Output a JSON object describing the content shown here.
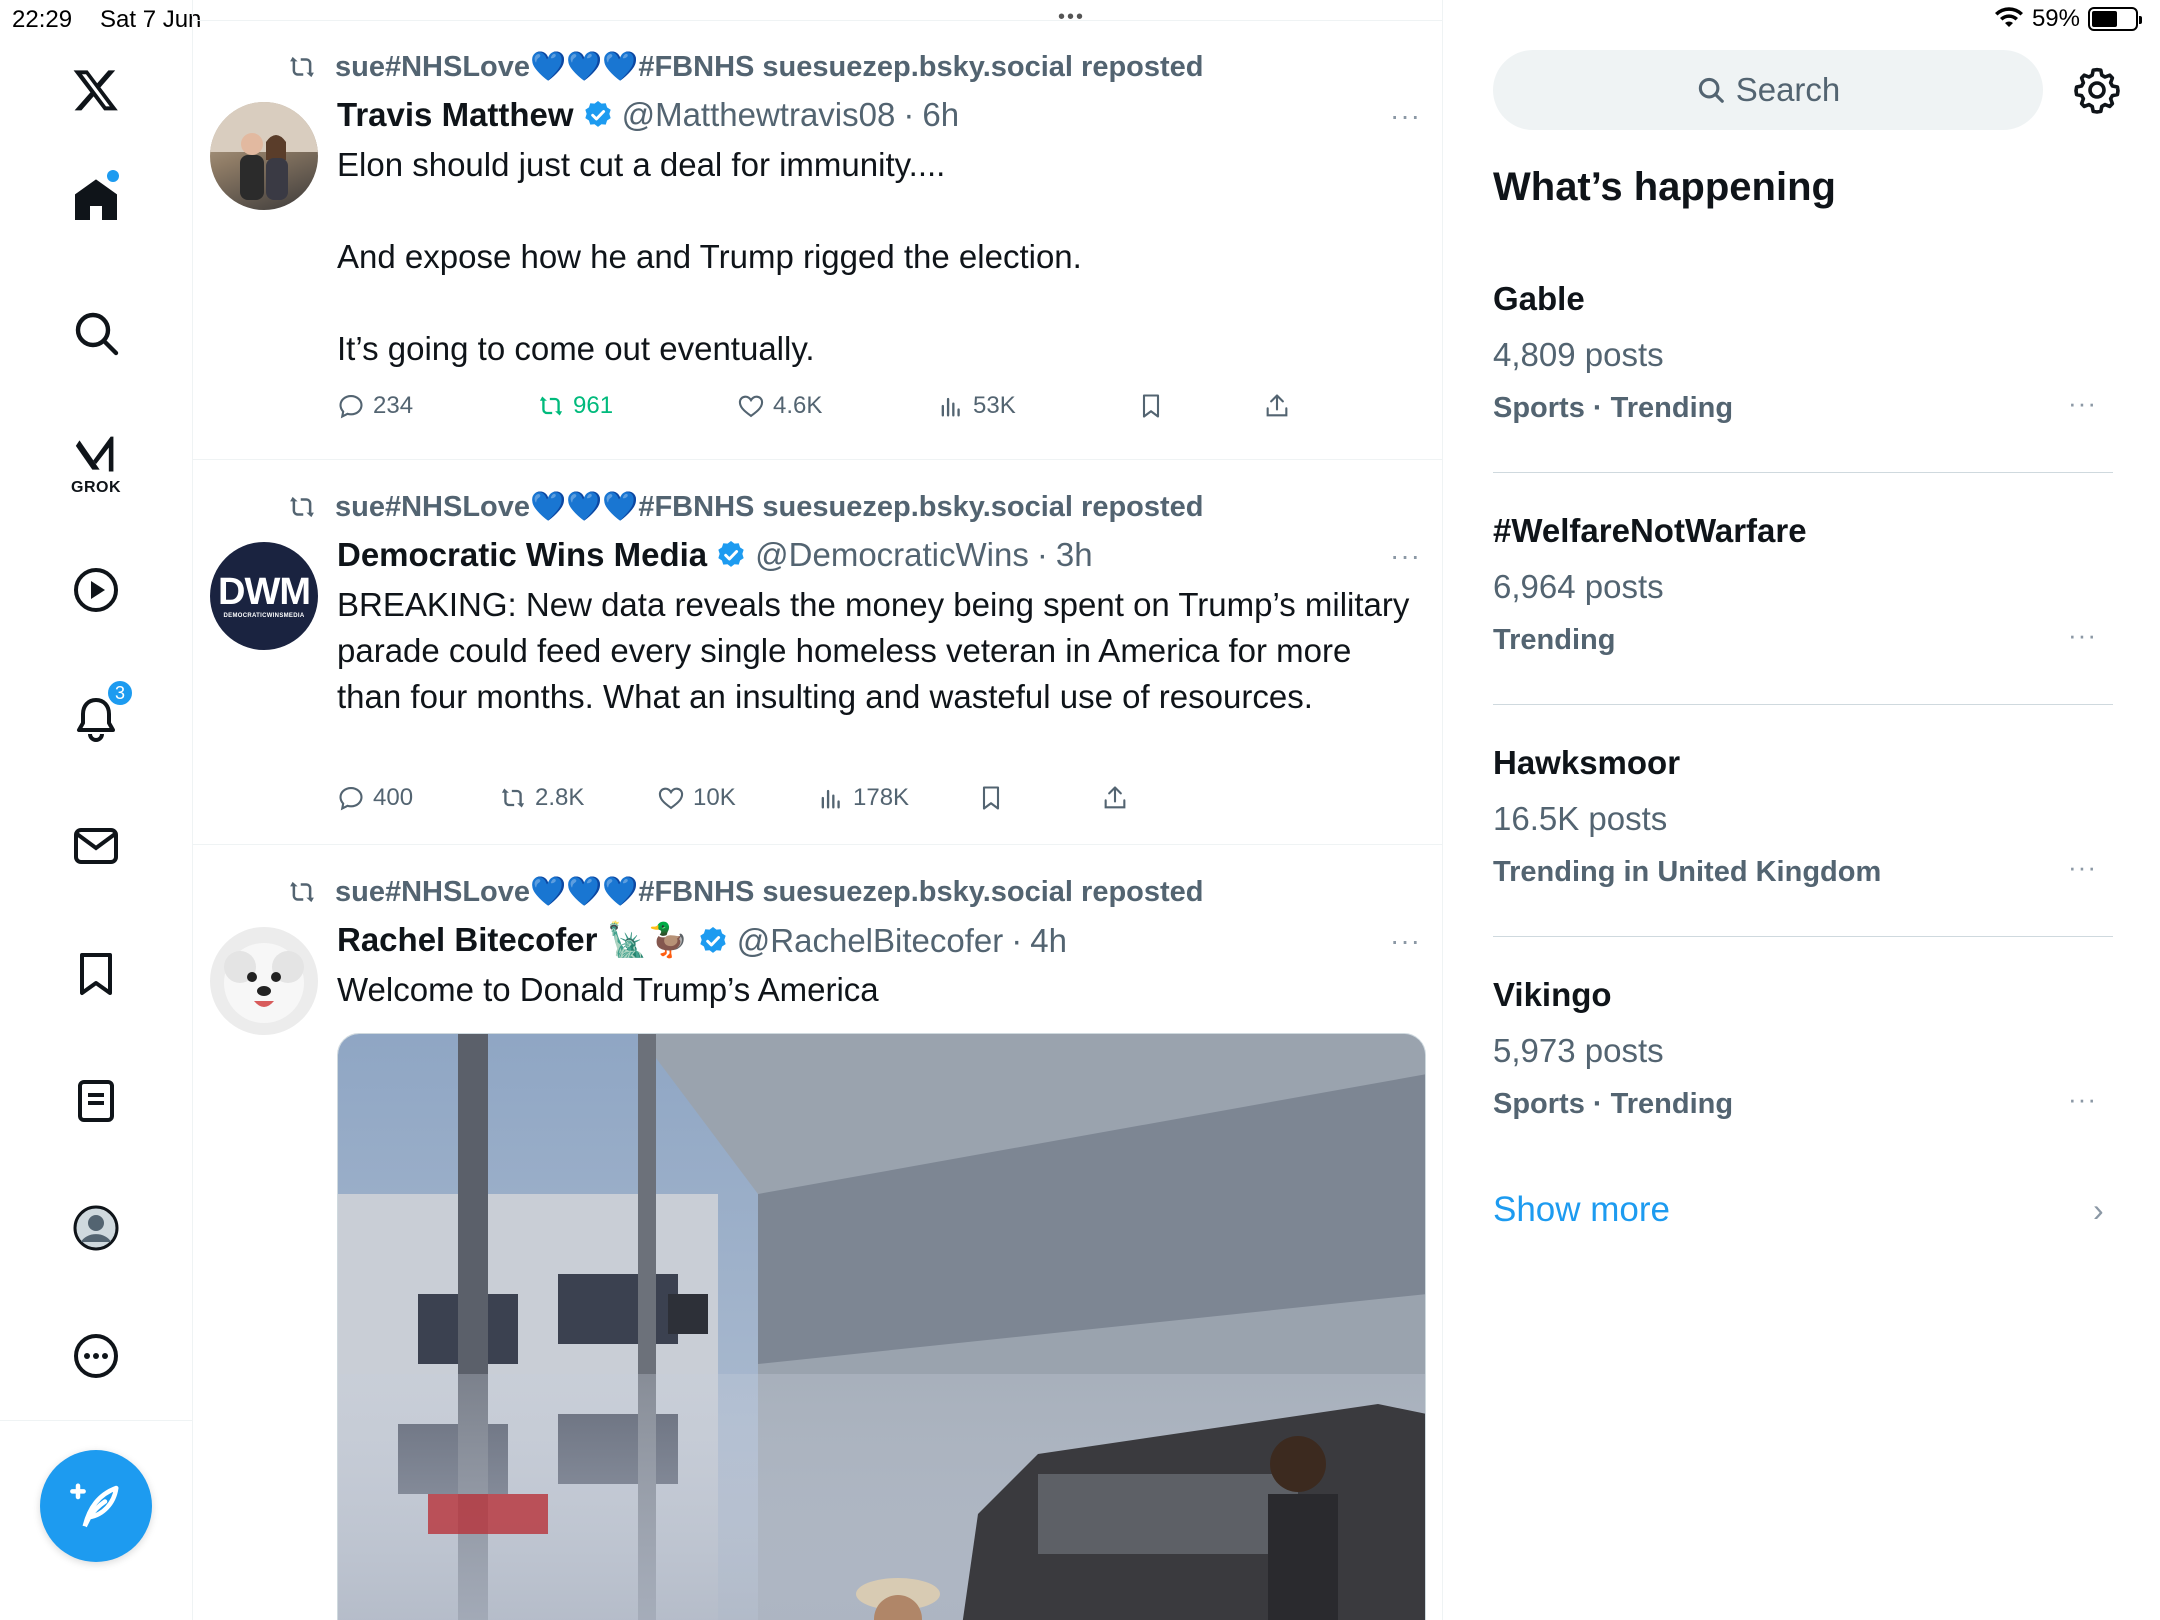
{
  "status_bar": {
    "time": "22:29",
    "date": "Sat 7 Jun",
    "battery": "59%",
    "battery_level": 0.59
  },
  "nav": {
    "items": [
      "x-logo",
      "home",
      "search",
      "grok",
      "video",
      "notifications",
      "messages",
      "bookmarks",
      "lists",
      "profile",
      "more"
    ],
    "grok_label": "GROK",
    "notifications_badge": "3"
  },
  "feed": {
    "posts": [
      {
        "repost_text": "sue#NHSLove💙💙💙#FBNHS suesuezep.bsky.social reposted",
        "author": "Travis Matthew",
        "handle": "@Matthewtravis08",
        "time": "6h",
        "text": "Elon should just cut a deal for immunity....\n\nAnd expose how he and Trump rigged the election.\n\nIt’s going to come out eventually.",
        "replies": "234",
        "reposts": "961",
        "likes": "4.6K",
        "views": "53K"
      },
      {
        "repost_text": "sue#NHSLove💙💙💙#FBNHS suesuezep.bsky.social reposted",
        "author": "Democratic Wins Media",
        "handle": "@DemocraticWins",
        "time": "3h",
        "text": "BREAKING: New data reveals the money being spent on Trump’s military parade could feed every single homeless veteran in America for more than four months. What an insulting and wasteful use of resources.",
        "avatar_text": "DWM",
        "avatar_subtext": "DEMOCRATICWINSMEDIA",
        "replies": "400",
        "reposts": "2.8K",
        "likes": "10K",
        "views": "178K"
      },
      {
        "repost_text": "sue#NHSLove💙💙💙#FBNHS suesuezep.bsky.social reposted",
        "author": "Rachel Bitecofer 🗽🦆",
        "handle": "@RachelBitecofer",
        "time": "4h",
        "text": "Welcome to Donald Trump’s America"
      }
    ],
    "time_separator": "·",
    "more": "···"
  },
  "sidebar": {
    "search_placeholder": "Search",
    "heading": "What’s happening",
    "trends": [
      {
        "topic": "Gable",
        "count": "4,809 posts",
        "context": "Sports · Trending"
      },
      {
        "topic": "#WelfareNotWarfare",
        "count": "6,964 posts",
        "context": "Trending"
      },
      {
        "topic": "Hawksmoor",
        "count": "16.5K posts",
        "context": "Trending in United Kingdom"
      },
      {
        "topic": "Vikingo",
        "count": "5,973 posts",
        "context": "Sports · Trending"
      }
    ],
    "show_more": "Show more",
    "more": "···"
  },
  "colors": {
    "accent": "#1d9bf0",
    "repost_green": "#00ba7c",
    "muted": "#536471"
  }
}
